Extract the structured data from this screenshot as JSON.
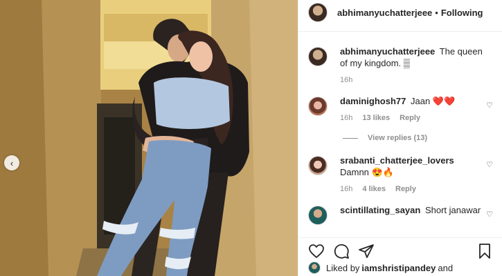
{
  "post": {
    "author": "abhimanyuchatterjeee",
    "separator": "•",
    "follow_status": "Following"
  },
  "comments": [
    {
      "username": "abhimanyuchatterjeee",
      "text": "The queen of my kingdom.",
      "emoji": "▒",
      "time": "16h"
    },
    {
      "username": "daminighosh77",
      "text": "Jaan",
      "emoji": "❤️❤️",
      "time": "16h",
      "likes": "13 likes",
      "reply_label": "Reply",
      "view_replies": "View replies (13)"
    },
    {
      "username": "srabanti_chatterjee_lovers",
      "text": "Damnn",
      "emoji": "😍🔥",
      "time": "16h",
      "likes": "4 likes",
      "reply_label": "Reply"
    },
    {
      "username": "scintillating_sayan",
      "text": "Short janawar",
      "emoji": ""
    }
  ],
  "likes": {
    "prefix": "Liked by",
    "user": "iamshristipandey",
    "suffix": "and"
  },
  "icons": {
    "carousel_prev": "chevron-left-icon",
    "like": "heart-icon",
    "comment": "comment-icon",
    "share": "paper-plane-icon",
    "save": "bookmark-icon"
  },
  "colors": {
    "text": "#262626",
    "muted": "#8e8e8e",
    "divider": "#efefef",
    "heart_red": "#ed4956"
  }
}
